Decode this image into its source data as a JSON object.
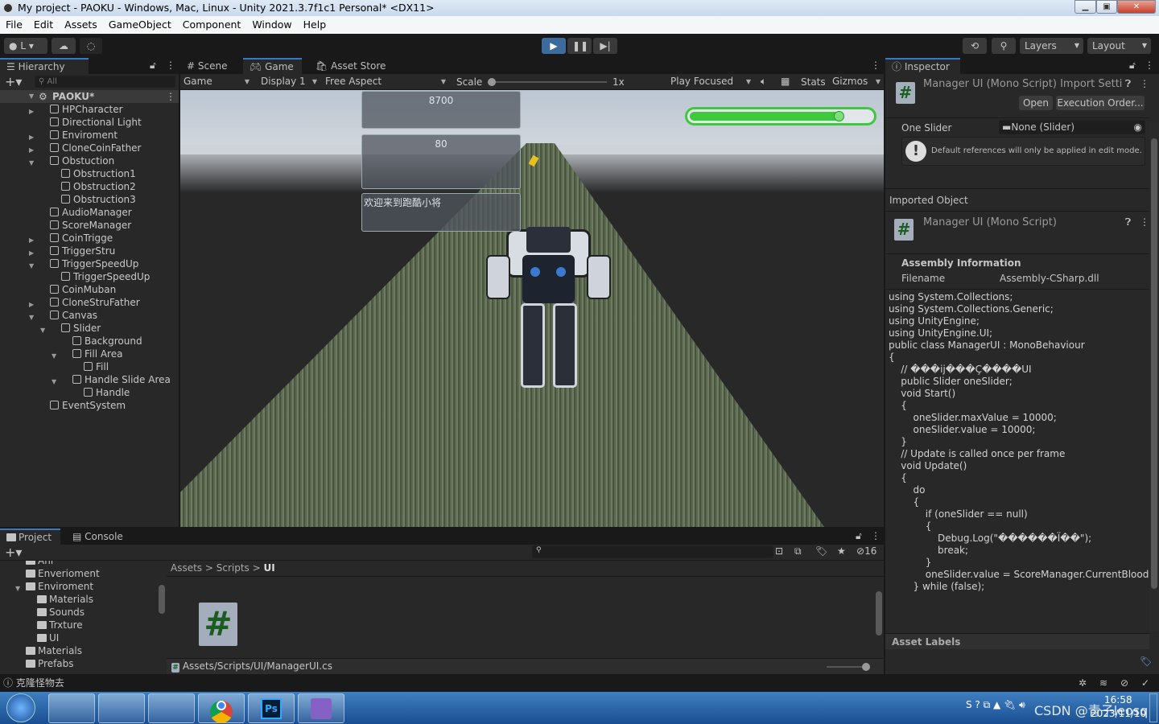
{
  "window": {
    "title": "My project - PAOKU - Windows, Mac, Linux - Unity 2021.3.7f1c1 Personal* <DX11>"
  },
  "menu": [
    "File",
    "Edit",
    "Assets",
    "GameObject",
    "Component",
    "Window",
    "Help"
  ],
  "toolbar": {
    "account": "L",
    "layers": "Layers",
    "layout": "Layout"
  },
  "hierarchy": {
    "tab": "Hierarchy",
    "search_placeholder": "All",
    "scene": "PAOKU*",
    "items": [
      {
        "label": "HPCharacter",
        "level": 1,
        "arrow": "right"
      },
      {
        "label": "Directional Light",
        "level": 1,
        "arrow": ""
      },
      {
        "label": "Enviroment",
        "level": 1,
        "arrow": "right"
      },
      {
        "label": "CloneCoinFather",
        "level": 1,
        "arrow": "right"
      },
      {
        "label": "Obstuction",
        "level": 1,
        "arrow": "down"
      },
      {
        "label": "Obstruction1",
        "level": 2,
        "arrow": ""
      },
      {
        "label": "Obstruction2",
        "level": 2,
        "arrow": ""
      },
      {
        "label": "Obstruction3",
        "level": 2,
        "arrow": ""
      },
      {
        "label": "AudioManager",
        "level": 1,
        "arrow": ""
      },
      {
        "label": "ScoreManager",
        "level": 1,
        "arrow": ""
      },
      {
        "label": "CoinTrigge",
        "level": 1,
        "arrow": "right"
      },
      {
        "label": "TriggerStru",
        "level": 1,
        "arrow": "right"
      },
      {
        "label": "TriggerSpeedUp",
        "level": 1,
        "arrow": "down"
      },
      {
        "label": "TriggerSpeedUp",
        "level": 2,
        "arrow": ""
      },
      {
        "label": "CoinMuban",
        "level": 1,
        "arrow": ""
      },
      {
        "label": "CloneStruFather",
        "level": 1,
        "arrow": "right"
      },
      {
        "label": "Canvas",
        "level": 1,
        "arrow": "down"
      },
      {
        "label": "Slider",
        "level": 2,
        "arrow": "down"
      },
      {
        "label": "Background",
        "level": 3,
        "arrow": ""
      },
      {
        "label": "Fill Area",
        "level": 3,
        "arrow": "down"
      },
      {
        "label": "Fill",
        "level": 4,
        "arrow": ""
      },
      {
        "label": "Handle Slide Area",
        "level": 3,
        "arrow": "down"
      },
      {
        "label": "Handle",
        "level": 4,
        "arrow": ""
      },
      {
        "label": "EventSystem",
        "level": 1,
        "arrow": ""
      }
    ]
  },
  "center": {
    "tabs": [
      "Scene",
      "Game",
      "Asset Store"
    ],
    "game_dd": "Game",
    "display": "Display 1",
    "aspect": "Free Aspect",
    "scale_label": "Scale",
    "scale_value": "1x",
    "play_focused": "Play Focused",
    "stats": "Stats",
    "gizmos": "Gizmos"
  },
  "game_ui": {
    "score": "8700",
    "hp": "80",
    "welcome": "欢迎来到跑酷小将",
    "health_fraction": 0.83,
    "health_color": "#3dc83d"
  },
  "inspector": {
    "tab": "Inspector",
    "header": "Manager UI (Mono Script) Import Settir",
    "open": "Open",
    "execution_order": "Execution Order...",
    "one_slider_label": "One Slider",
    "one_slider_value": "None (Slider)",
    "info": "Default references will only be applied in edit mode.",
    "imported_object": "Imported Object",
    "imported_title": "Manager UI (Mono Script)",
    "assembly_info": "Assembly Information",
    "filename_label": "Filename",
    "filename_value": "Assembly-CSharp.dll",
    "code": [
      "using System.Collections;",
      "using System.Collections.Generic;",
      "using UnityEngine;",
      "using UnityEngine.UI;",
      "",
      "public class ManagerUI : MonoBehaviour",
      "{",
      "    // ���ĳ���Ç����UI",
      "    public Slider oneSlider;",
      "    void Start()",
      "    {",
      "        oneSlider.maxValue = 10000;",
      "        oneSlider.value = 10000;",
      "    }",
      "",
      "    // Update is called once per frame",
      "    void Update()",
      "    {",
      "        do",
      "        {",
      "            if (oneSlider == null)",
      "            {",
      "                Debug.Log(\"������Ï��\");",
      "                break;",
      "            }",
      "            oneSlider.value = ScoreManager.CurrentBlood;",
      "",
      "        } while (false);"
    ],
    "asset_labels": "Asset Labels"
  },
  "project": {
    "tabs": [
      "Project",
      "Console"
    ],
    "hidden_count": "16",
    "tree": [
      {
        "label": "Ani",
        "level": 1
      },
      {
        "label": "Enverioment",
        "level": 1
      },
      {
        "label": "Enviroment",
        "level": 1,
        "open": true
      },
      {
        "label": "Materials",
        "level": 2
      },
      {
        "label": "Sounds",
        "level": 2
      },
      {
        "label": "Trxture",
        "level": 2
      },
      {
        "label": "UI",
        "level": 2
      },
      {
        "label": "Materials",
        "level": 1
      },
      {
        "label": "Prefabs",
        "level": 1
      }
    ],
    "breadcrumb": [
      "Assets",
      "Scripts",
      "UI"
    ],
    "selected_path": "Assets/Scripts/UI/ManagerUI.cs"
  },
  "status": {
    "message": "克隆怪物去"
  },
  "taskbar": {
    "time": "16:58",
    "date": "2023/11/10",
    "watermark": "CSDN @青子leosq"
  }
}
